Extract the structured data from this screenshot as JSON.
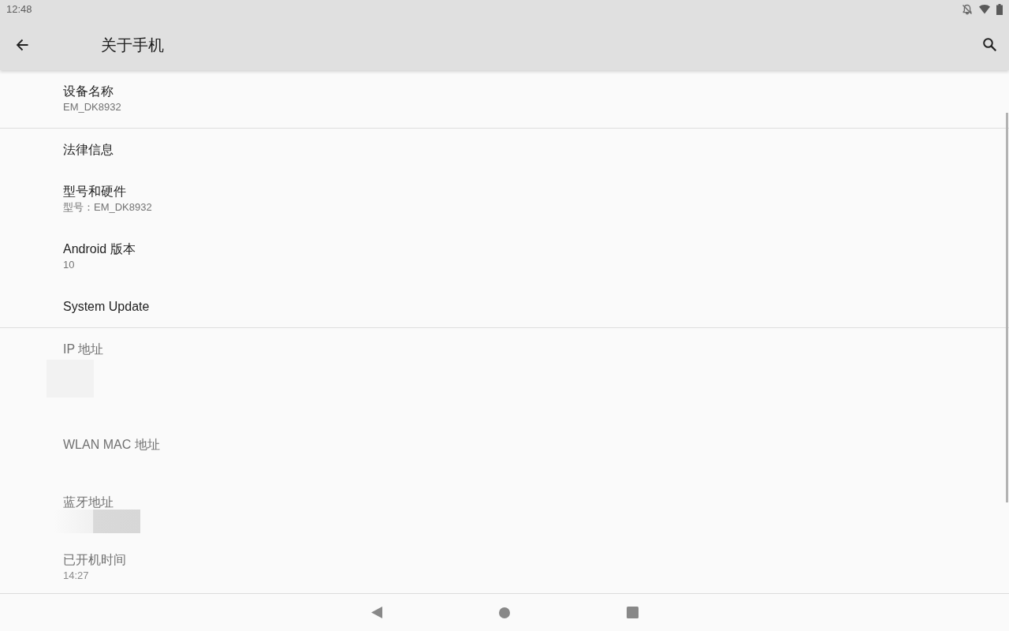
{
  "status_bar": {
    "time": "12:48"
  },
  "toolbar": {
    "title": "关于手机"
  },
  "sections": [
    {
      "items": [
        {
          "kind": "plain",
          "title": "设备名称",
          "summary": "EM_DK8932",
          "disabled": false
        }
      ]
    },
    {
      "items": [
        {
          "kind": "plain",
          "title": "法律信息",
          "disabled": false
        },
        {
          "kind": "plain",
          "title": "型号和硬件",
          "summary": "型号：EM_DK8932",
          "disabled": false
        },
        {
          "kind": "plain",
          "title": "Android 版本",
          "summary": "10",
          "disabled": false
        },
        {
          "kind": "plain",
          "title": "System Update",
          "disabled": false
        }
      ]
    },
    {
      "items": [
        {
          "kind": "redacted",
          "title": "IP 地址",
          "disabled": true
        },
        {
          "kind": "hidden",
          "title": "WLAN MAC 地址",
          "disabled": true
        },
        {
          "kind": "smudged",
          "title": "蓝牙地址",
          "disabled": true
        },
        {
          "kind": "plain",
          "title": "已开机时间",
          "summary": "14:27",
          "disabled": true
        }
      ]
    }
  ]
}
